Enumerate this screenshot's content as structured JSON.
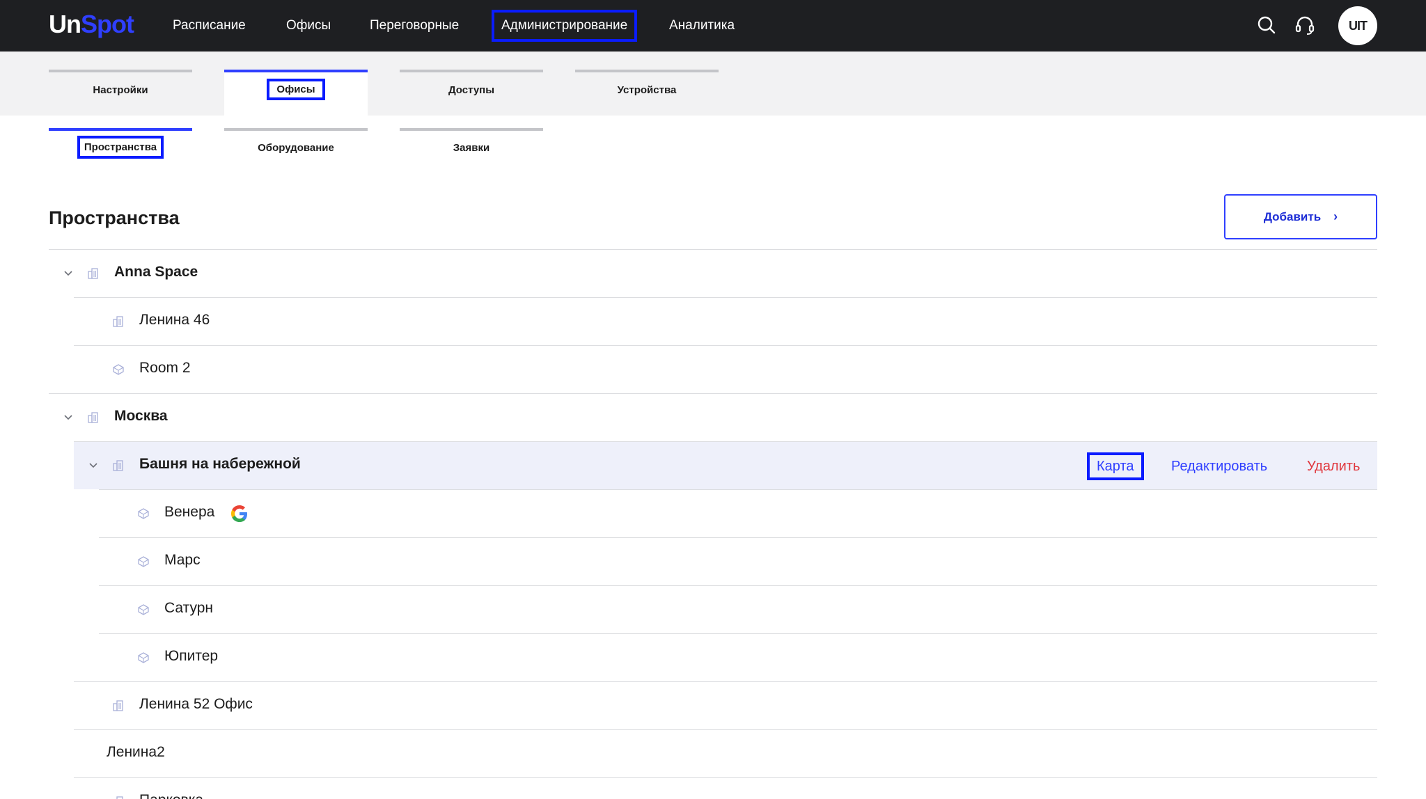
{
  "brand": {
    "part1": "Un",
    "part2": "Spot",
    "accent": "#2f3fff"
  },
  "nav": {
    "items": [
      "Расписание",
      "Офисы",
      "Переговорные",
      "Администрирование",
      "Аналитика"
    ],
    "active": "Администрирование",
    "avatar_text": "UIT",
    "icons": [
      "search-icon",
      "headset-icon"
    ]
  },
  "tabs_primary": {
    "items": [
      "Настройки",
      "Офисы",
      "Доступы",
      "Устройства"
    ],
    "active": "Офисы"
  },
  "tabs_secondary": {
    "items": [
      "Пространства",
      "Оборудование",
      "Заявки"
    ],
    "active": "Пространства"
  },
  "page": {
    "title": "Пространства",
    "add_label": "Добавить"
  },
  "tree": {
    "rows": [
      {
        "label": "Anna Space",
        "kind": "building",
        "bold": true,
        "expandable": true
      },
      {
        "label": "Ленина 46",
        "kind": "building",
        "bold": false
      },
      {
        "label": "Room 2",
        "kind": "room",
        "bold": false
      },
      {
        "label": "Москва",
        "kind": "building",
        "bold": true,
        "expandable": true
      },
      {
        "label": "Башня на набережной",
        "kind": "building",
        "bold": true,
        "expandable": true,
        "highlighted": true
      },
      {
        "label": "Венера",
        "kind": "room",
        "bold": false,
        "badge": "google-icon"
      },
      {
        "label": "Марс",
        "kind": "room",
        "bold": false
      },
      {
        "label": "Сатурн",
        "kind": "room",
        "bold": false
      },
      {
        "label": "Юпитер",
        "kind": "room",
        "bold": false
      },
      {
        "label": "Ленина 52 Офис",
        "kind": "building",
        "bold": false
      },
      {
        "label": "Ленина2",
        "kind": "none",
        "bold": false
      },
      {
        "label": "Парковка",
        "kind": "building",
        "bold": false
      }
    ],
    "actions": {
      "map": "Карта",
      "edit": "Редактировать",
      "delete": "Удалить"
    }
  },
  "colors": {
    "topbar": "#1e1f22",
    "accent": "#2f3fff",
    "highlight_box": "#0a1cff",
    "danger": "#e0383e",
    "row_highlight": "#eef0fa"
  }
}
